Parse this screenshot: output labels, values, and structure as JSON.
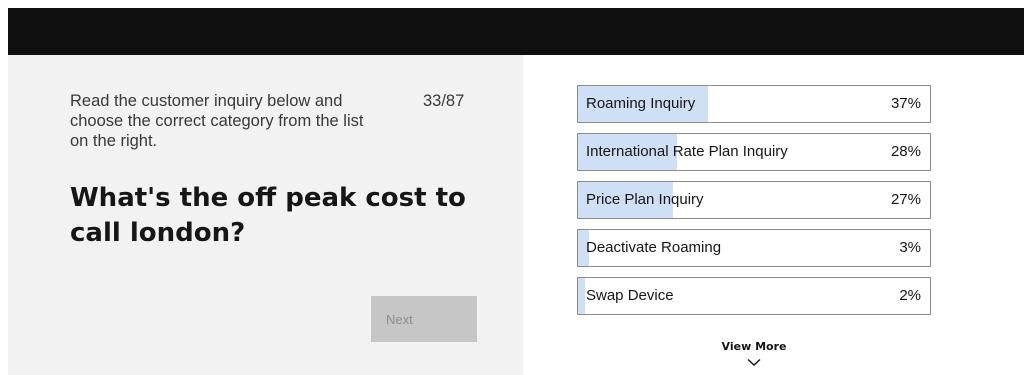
{
  "instructions": "Read the customer inquiry below and choose the correct category from the list on the right.",
  "counter": "33/87",
  "question": "What's the off peak cost to call london?",
  "next_label": "Next",
  "options": [
    {
      "label": "Roaming Inquiry",
      "percent": "37%",
      "fill": 0.37
    },
    {
      "label": "International Rate Plan Inquiry",
      "percent": "28%",
      "fill": 0.28
    },
    {
      "label": "Price Plan Inquiry",
      "percent": "27%",
      "fill": 0.27
    },
    {
      "label": "Deactivate Roaming",
      "percent": "3%",
      "fill": 0.03
    },
    {
      "label": "Swap Device",
      "percent": "2%",
      "fill": 0.02
    }
  ],
  "view_more_label": "View More",
  "view_more_icon": "chevron-down-icon",
  "colors": {
    "bar_fill": "#cfe0f6",
    "top_bar": "#0f0f0f",
    "panel": "#f2f2f2"
  }
}
